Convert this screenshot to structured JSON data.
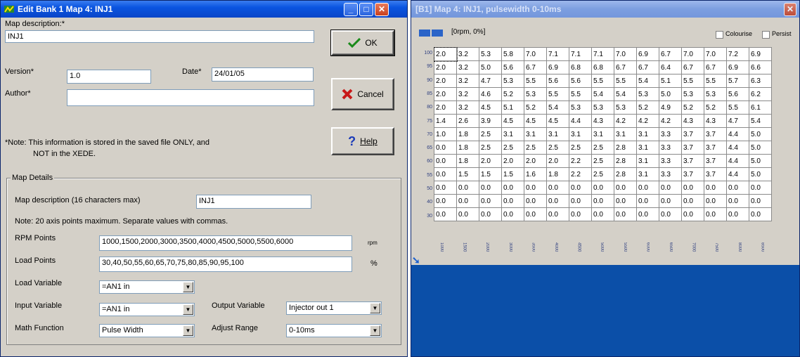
{
  "dialog": {
    "title": "Edit Bank 1 Map 4: INJ1",
    "map_description_label": "Map description:*",
    "map_description_value": "INJ1",
    "version_label": "Version*",
    "version_value": "1.0",
    "date_label": "Date*",
    "date_value": "24/01/05",
    "author_label": "Author*",
    "author_value": "",
    "note_line1": "*Note: This information is stored in the saved file ONLY, and",
    "note_line2": "NOT in the XEDE.",
    "ok_label": "OK",
    "cancel_label": "Cancel",
    "help_label": "Help",
    "map_details": {
      "group_title": "Map Details",
      "desc_label": "Map description (16 characters max)",
      "desc_value": "INJ1",
      "axis_note": "Note: 20 axis points maximum.  Separate values with commas.",
      "rpm_label": "RPM Points",
      "rpm_value": "1000,1500,2000,3000,3500,4000,4500,5000,5500,6000",
      "rpm_unit": "rpm",
      "load_label": "Load Points",
      "load_value": "30,40,50,55,60,65,70,75,80,85,90,95,100",
      "load_unit": "%",
      "load_var_label": "Load Variable",
      "load_var_value": "=AN1 in",
      "input_var_label": "Input Variable",
      "input_var_value": "=AN1 in",
      "output_var_label": "Output Variable",
      "output_var_value": "Injector out 1",
      "math_label": "Math Function",
      "math_value": "Pulse Width",
      "adjust_label": "Adjust Range",
      "adjust_value": "0-10ms"
    }
  },
  "map_window": {
    "title": "[B1] Map 4: INJ1, pulsewidth 0-10ms",
    "cursor_info": "[0rpm, 0%]",
    "colourise_label": "Colourise",
    "persist_label": "Persist",
    "row_labels": [
      "100",
      "95",
      "90",
      "85",
      "80",
      "75",
      "70",
      "65",
      "60",
      "55",
      "50",
      "40",
      "30"
    ],
    "col_labels": [
      "1000",
      "1500",
      "2000",
      "3000",
      "3500",
      "4000",
      "4500",
      "5000",
      "5500",
      "6000",
      "6500",
      "7000",
      "7500",
      "8000",
      "8500",
      "9000"
    ],
    "rows": [
      [
        "2.0",
        "3.2",
        "5.3",
        "5.8",
        "7.0",
        "7.1",
        "7.1",
        "7.1",
        "7.0",
        "6.9",
        "6.7",
        "7.0",
        "7.0",
        "7.2",
        "6.9"
      ],
      [
        "2.0",
        "3.2",
        "5.0",
        "5.6",
        "6.7",
        "6.9",
        "6.8",
        "6.8",
        "6.7",
        "6.7",
        "6.4",
        "6.7",
        "6.7",
        "6.9",
        "6.6"
      ],
      [
        "2.0",
        "3.2",
        "4.7",
        "5.3",
        "5.5",
        "5.6",
        "5.6",
        "5.5",
        "5.5",
        "5.4",
        "5.1",
        "5.5",
        "5.5",
        "5.7",
        "6.3"
      ],
      [
        "2.0",
        "3.2",
        "4.6",
        "5.2",
        "5.3",
        "5.5",
        "5.5",
        "5.4",
        "5.4",
        "5.3",
        "5.0",
        "5.3",
        "5.3",
        "5.6",
        "6.2"
      ],
      [
        "2.0",
        "3.2",
        "4.5",
        "5.1",
        "5.2",
        "5.4",
        "5.3",
        "5.3",
        "5.3",
        "5.2",
        "4.9",
        "5.2",
        "5.2",
        "5.5",
        "6.1"
      ],
      [
        "1.4",
        "2.6",
        "3.9",
        "4.5",
        "4.5",
        "4.5",
        "4.4",
        "4.3",
        "4.2",
        "4.2",
        "4.2",
        "4.3",
        "4.3",
        "4.7",
        "5.4"
      ],
      [
        "1.0",
        "1.8",
        "2.5",
        "3.1",
        "3.1",
        "3.1",
        "3.1",
        "3.1",
        "3.1",
        "3.1",
        "3.3",
        "3.7",
        "3.7",
        "4.4",
        "5.0"
      ],
      [
        "0.0",
        "1.8",
        "2.5",
        "2.5",
        "2.5",
        "2.5",
        "2.5",
        "2.5",
        "2.8",
        "3.1",
        "3.3",
        "3.7",
        "3.7",
        "4.4",
        "5.0"
      ],
      [
        "0.0",
        "1.8",
        "2.0",
        "2.0",
        "2.0",
        "2.0",
        "2.2",
        "2.5",
        "2.8",
        "3.1",
        "3.3",
        "3.7",
        "3.7",
        "4.4",
        "5.0"
      ],
      [
        "0.0",
        "1.5",
        "1.5",
        "1.5",
        "1.6",
        "1.8",
        "2.2",
        "2.5",
        "2.8",
        "3.1",
        "3.3",
        "3.7",
        "3.7",
        "4.4",
        "5.0"
      ],
      [
        "0.0",
        "0.0",
        "0.0",
        "0.0",
        "0.0",
        "0.0",
        "0.0",
        "0.0",
        "0.0",
        "0.0",
        "0.0",
        "0.0",
        "0.0",
        "0.0",
        "0.0"
      ],
      [
        "0.0",
        "0.0",
        "0.0",
        "0.0",
        "0.0",
        "0.0",
        "0.0",
        "0.0",
        "0.0",
        "0.0",
        "0.0",
        "0.0",
        "0.0",
        "0.0",
        "0.0"
      ],
      [
        "0.0",
        "0.0",
        "0.0",
        "0.0",
        "0.0",
        "0.0",
        "0.0",
        "0.0",
        "0.0",
        "0.0",
        "0.0",
        "0.0",
        "0.0",
        "0.0",
        "0.0"
      ]
    ]
  }
}
